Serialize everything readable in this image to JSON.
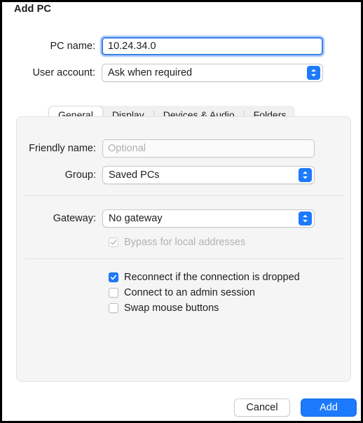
{
  "dialog": {
    "title": "Add PC"
  },
  "top_form": {
    "pc_name": {
      "label": "PC name:",
      "value": "10.24.34.0"
    },
    "user_account": {
      "label": "User account:",
      "value": "Ask when required"
    }
  },
  "tabs": [
    {
      "label": "General",
      "selected": true
    },
    {
      "label": "Display",
      "selected": false
    },
    {
      "label": "Devices & Audio",
      "selected": false
    },
    {
      "label": "Folders",
      "selected": false
    }
  ],
  "general": {
    "friendly_name": {
      "label": "Friendly name:",
      "value": "",
      "placeholder": "Optional"
    },
    "group": {
      "label": "Group:",
      "value": "Saved PCs"
    },
    "gateway": {
      "label": "Gateway:",
      "value": "No gateway"
    },
    "bypass": {
      "label": "Bypass for local addresses",
      "checked": true,
      "disabled": true
    },
    "options": [
      {
        "label": "Reconnect if the connection is dropped",
        "checked": true
      },
      {
        "label": "Connect to an admin session",
        "checked": false
      },
      {
        "label": "Swap mouse buttons",
        "checked": false
      }
    ]
  },
  "footer": {
    "cancel_label": "Cancel",
    "add_label": "Add"
  },
  "colors": {
    "accent": "#1d7afc",
    "focus_ring": "#3d7fe8",
    "panel_bg": "#f5f5f5",
    "tabbar_track": "#f0f0f0",
    "text": "#1d1d1f",
    "disabled_text": "#b2b2b5"
  }
}
